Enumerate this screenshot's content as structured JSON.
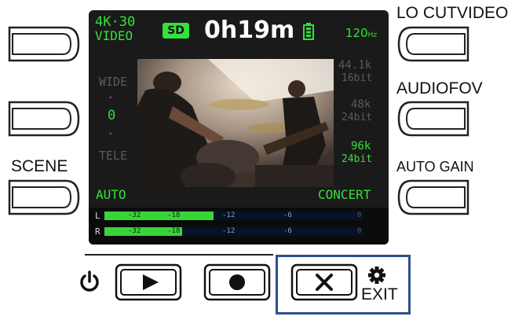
{
  "labels": {
    "lo_cut": "LO CUTVIDEO",
    "audio_fov": "AUDIOFOV",
    "scene": "SCENE",
    "auto_gain": "AUTO GAIN",
    "exit": "EXIT"
  },
  "screen": {
    "video_mode_line1": "4K·30",
    "video_mode_line2": "VIDEO",
    "storage": "SD",
    "remaining_time": "0h19m",
    "frame_rate": "120",
    "frame_rate_unit": "Hz",
    "zoom_wide": "WIDE",
    "zoom_dot1": "▪",
    "zoom_value": "0",
    "zoom_dot2": "▪",
    "zoom_tele": "TELE",
    "audio_options": [
      {
        "rate": "44.1k",
        "bits": "16bit",
        "active": false
      },
      {
        "rate": "48k",
        "bits": "24bit",
        "active": false
      },
      {
        "rate": "96k",
        "bits": "24bit",
        "active": true
      }
    ],
    "scene_mode": "AUTO",
    "audio_scene": "CONCERT",
    "meters": {
      "channels": [
        "L",
        "R"
      ],
      "ticks": [
        "-32",
        "-18",
        "-12",
        "-6",
        "0"
      ],
      "levels": [
        0.42,
        0.3
      ]
    }
  },
  "colors": {
    "screen_bg": "#1a1a1a",
    "accent_green": "#35e03a",
    "highlight_box": "#2f4f8f"
  }
}
